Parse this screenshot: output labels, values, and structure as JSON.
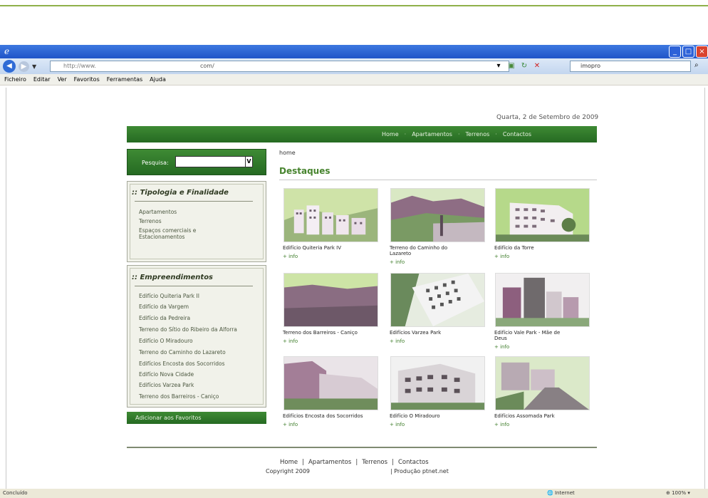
{
  "browser": {
    "address_prefix": "http://www.",
    "address_suffix": "com/",
    "search_text": "imopro",
    "menu": [
      "Ficheiro",
      "Editar",
      "Ver",
      "Favoritos",
      "Ferramentas",
      "Ajuda"
    ],
    "status_left": "Concluído",
    "status_zone": "Internet",
    "status_zoom": "100%"
  },
  "page": {
    "date": "Quarta, 2 de Setembro de 2009",
    "nav": [
      "Home",
      "Apartamentos",
      "Terrenos",
      "Contactos"
    ],
    "nav_sep": "·",
    "search_label": "Pesquisa:",
    "search_select_glyph": "V",
    "tipologia_title": ":: Tipologia e Finalidade",
    "tipologia_items": [
      "Apartamentos",
      "Terrenos",
      "Espaços comerciais e",
      "Estacionamentos"
    ],
    "empreend_title": ":: Empreendimentos",
    "empreend_items": [
      "Edifício Quiteria Park II",
      "Edifício da Vargem",
      "Edifício da Pedreira",
      "Terreno do Sítio do Ribeiro da Alforra",
      "Edifício O Miradouro",
      "Terreno do Caminho do Lazareto",
      "Edifícios Encosta dos Socorridos",
      "Edifício Nova Cidade",
      "Edifícios Varzea Park",
      "Terreno dos Barreiros - Caniço"
    ],
    "favoritos": "Adicionar aos Favoritos",
    "breadcrumb": "home",
    "destaques": "Destaques",
    "more_label": "+ info",
    "cards": [
      {
        "l1": "Edifício Quiteria Park IV",
        "l2": ""
      },
      {
        "l1": "Terreno do Caminho do",
        "l2": "Lazareto"
      },
      {
        "l1": "Edifício da Torre",
        "l2": ""
      },
      {
        "l1": "Terreno dos Barreiros - Caniço",
        "l2": ""
      },
      {
        "l1": "Edifícios Varzea Park",
        "l2": ""
      },
      {
        "l1": "Edifício Vale Park - Mãe de",
        "l2": "Deus"
      },
      {
        "l1": "Edifícios Encosta dos Socorridos",
        "l2": ""
      },
      {
        "l1": "Edifício O Miradouro",
        "l2": ""
      },
      {
        "l1": "Edifícios Assomada Park",
        "l2": ""
      }
    ],
    "footer_links": [
      "Home",
      "Apartamentos",
      "Terrenos",
      "Contactos"
    ],
    "footer_sep": "|",
    "copyright": "Copyright 2009",
    "producao": "| Produção ptnet.net"
  },
  "colors": {
    "brand_green": "#2f7a2a",
    "accent_green": "#47842e",
    "photo_tint": "#b9d78a"
  }
}
